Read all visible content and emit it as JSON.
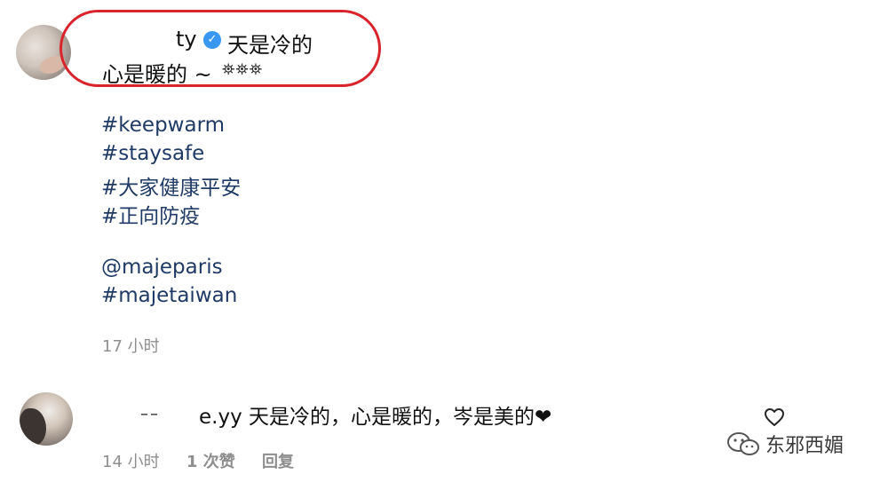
{
  "post": {
    "username": "ty",
    "caption_line1": "天是冷的",
    "caption_line2": "心是暖的 ~",
    "caption_emoji": "⛯⛯⛯",
    "hashtags": [
      "#keepwarm",
      "#staysafe",
      "#大家健康平安",
      "#正向防疫"
    ],
    "mentions": [
      "@majeparis",
      "#majetaiwan"
    ],
    "time": "17 小时"
  },
  "reply": {
    "username_partial": "––",
    "text": "e.yy 天是冷的，心是暖的，岑是美的❤",
    "time": "14 小时",
    "likes": "1 次赞",
    "reply_label": "回复"
  },
  "watermark": {
    "text": "东邪西媚"
  },
  "colors": {
    "highlight": "#d8242c",
    "link": "#1f3a64",
    "verified": "#3897f0",
    "meta": "#8e8e8e"
  }
}
